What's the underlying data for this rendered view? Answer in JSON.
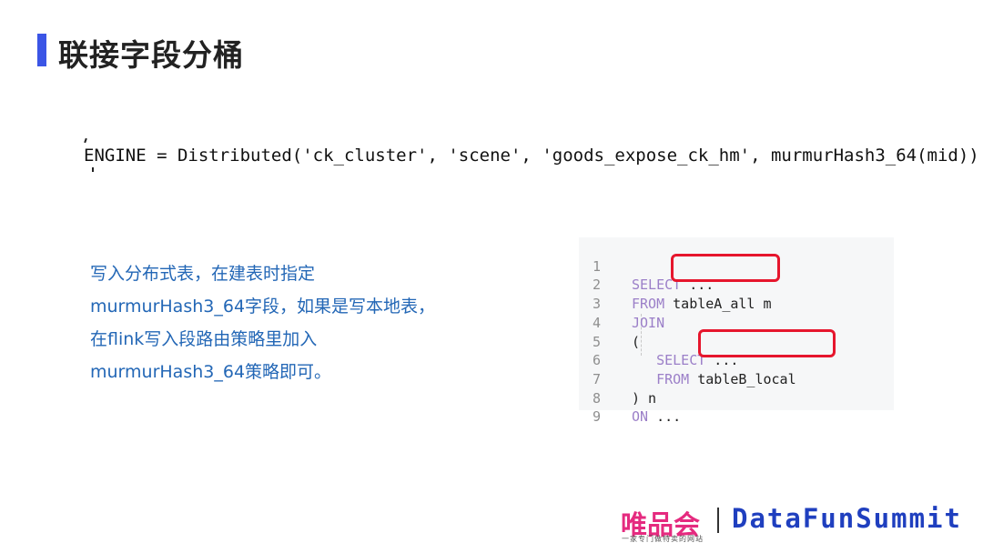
{
  "slide": {
    "title": "联接字段分桶",
    "engine_line": "ENGINE = Distributed('ck_cluster', 'scene', 'goods_expose_ck_hm', murmurHash3_64(mid))",
    "description_lines": [
      "写入分布式表，在建表时指定",
      "murmurHash3_64字段，如果是写本地表，",
      "在flink写入段路由策略里加入",
      "murmurHash3_64策略即可。"
    ]
  },
  "code": {
    "lines": [
      {
        "n": "1",
        "kw": "SELECT",
        "rest": " ..."
      },
      {
        "n": "2",
        "kw": "FROM",
        "rest": " tableA_all m"
      },
      {
        "n": "3",
        "kw": "JOIN",
        "rest": ""
      },
      {
        "n": "4",
        "kw": "",
        "rest": "("
      },
      {
        "n": "5",
        "kw": "   SELECT",
        "rest": " ..."
      },
      {
        "n": "6",
        "kw": "   FROM",
        "rest": " tableB_local"
      },
      {
        "n": "7",
        "kw": "",
        "rest": ") n"
      },
      {
        "n": "8",
        "kw": "ON",
        "rest": " ..."
      },
      {
        "n": "9",
        "kw": "",
        "rest": ""
      }
    ],
    "highlight_color": "#e6162d"
  },
  "footer": {
    "logo": "唯品会",
    "logo_tagline": "一家专门做特卖的网站",
    "brand": "DataFunSummit"
  },
  "colors": {
    "title_bar": "#3b55e6",
    "description": "#2367b6",
    "keyword": "#9b7fc8"
  }
}
